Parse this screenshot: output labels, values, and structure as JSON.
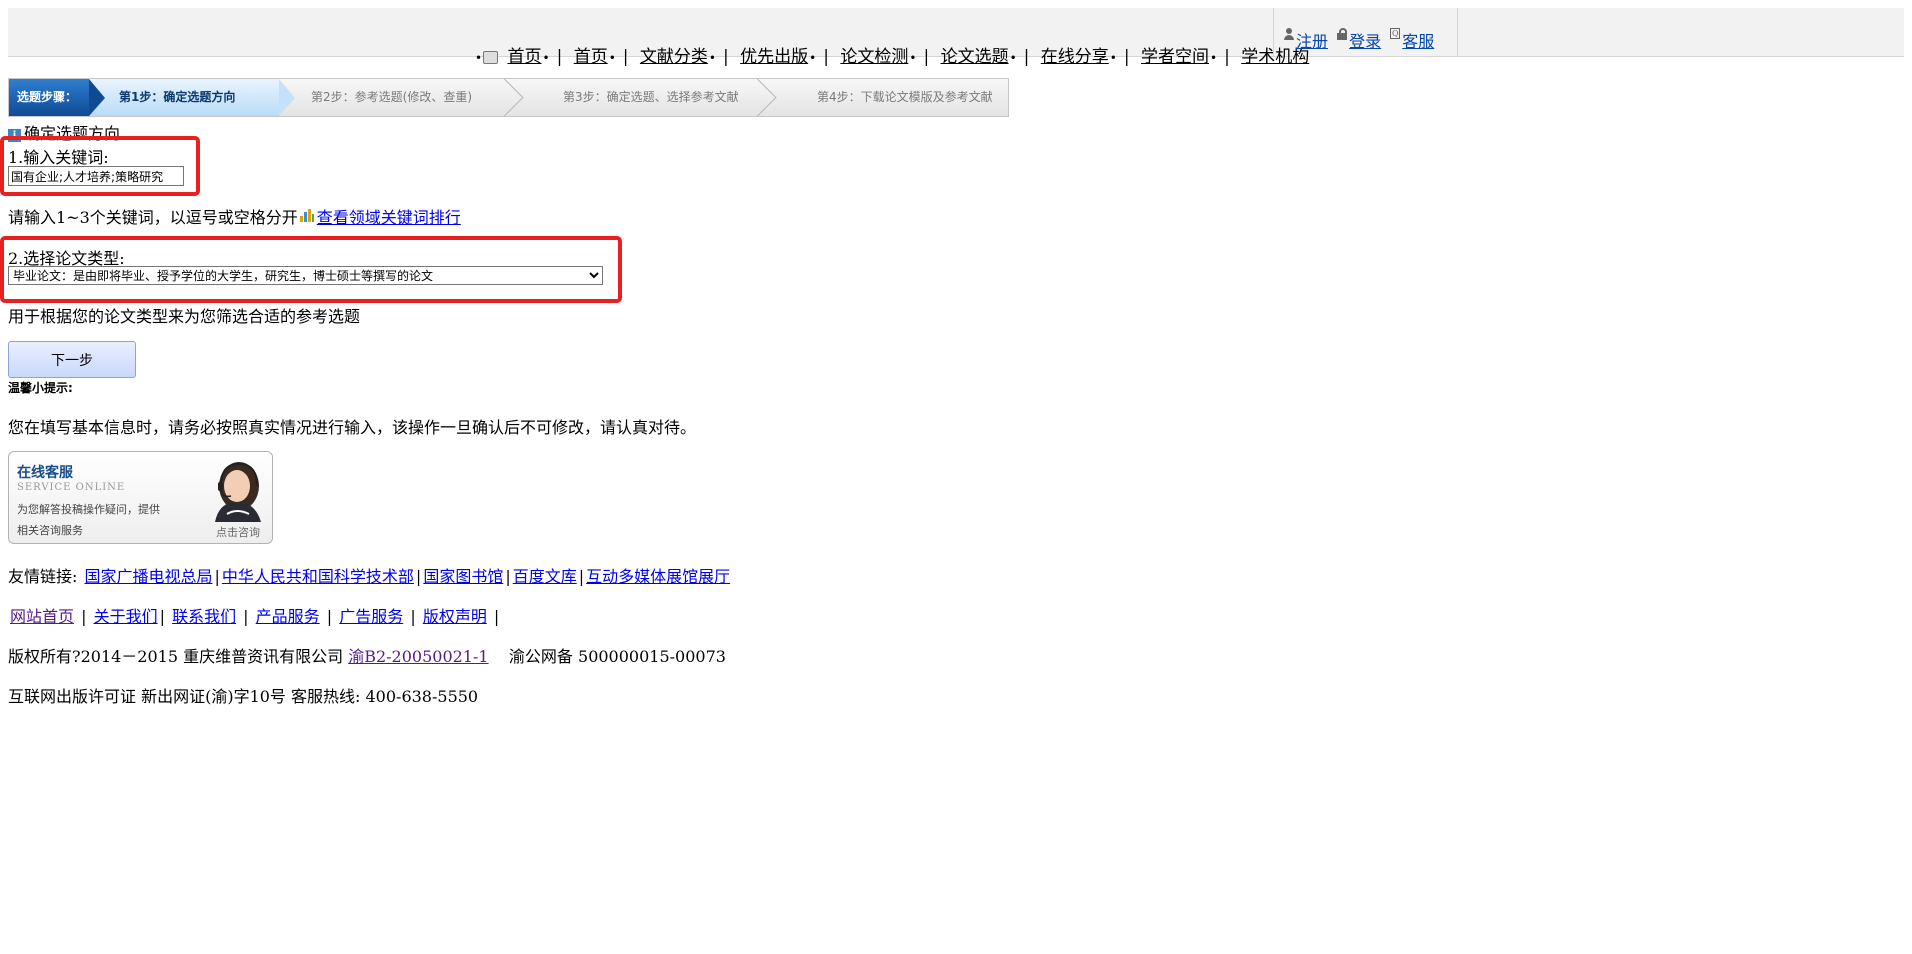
{
  "nav": {
    "items": [
      "首页",
      "首页",
      "文献分类",
      "优先出版",
      "论文检测",
      "论文选题",
      "在线分享",
      "学者空间",
      "学术机构"
    ]
  },
  "user_nav": {
    "register": "注册",
    "login": "登录",
    "service": "客服"
  },
  "steps": {
    "label": "选题步骤：",
    "step1": "第1步：确定选题方向",
    "step2": "第2步：参考选题(修改、查重)",
    "step3": "第3步：确定选题、选择参考文献",
    "step4": "第4步：下载论文模版及参考文献"
  },
  "form": {
    "section_title": "确定选题方向",
    "keyword_label": "1.输入关键词:",
    "keyword_value": "国有企业;人才培养;策略研究",
    "keyword_hint": "请输入1~3个关键词，以逗号或空格分开",
    "keyword_rank_link": "查看领域关键词排行",
    "type_label": "2.选择论文类型:",
    "type_selected": "毕业论文：是由即将毕业、授予学位的大学生，研究生，博士硕士等撰写的论文",
    "type_hint": "用于根据您的论文类型来为您筛选合适的参考选题",
    "next_button": "下一步",
    "tips_title": "温馨小提示:",
    "tips_text": "您在填写基本信息时，请务必按照真实情况进行输入，该操作一旦确认后不可修改，请认真对待。"
  },
  "service_box": {
    "title": "在线客服",
    "subtitle": "SERVICE ONLINE",
    "desc_line1": "为您解答投稿操作疑问，提供",
    "desc_line2": "相关咨询服务",
    "cta": "点击咨询"
  },
  "footer": {
    "friend_label": "友情链接:",
    "friend_links": [
      "国家广播电视总局",
      "中华人民共和国科学技术部",
      "国家图书馆",
      "百度文库",
      "互动多媒体展馆展厅"
    ],
    "site_links": [
      "网站首页",
      "关于我们",
      "联系我们",
      "产品服务",
      "广告服务",
      "版权声明"
    ],
    "copyright_prefix": "版权所有?2014－2015 重庆维普资讯有限公司",
    "icp_link": "渝B2-20050021-1",
    "police_record": "渝公网备 500000015-00073",
    "license": "互联网出版许可证 新出网证(渝)字10号 客服热线: 400-638-5550"
  },
  "colors": {
    "annotation_red": "#ea1f1f",
    "step_active": "#b9dcf7",
    "step_label_bg": "#0f4b94",
    "link": "#0000ee"
  },
  "icons": [
    "home-icon",
    "person-icon",
    "lock-icon",
    "service-icon",
    "info-icon",
    "chart-icon",
    "headset-avatar"
  ]
}
